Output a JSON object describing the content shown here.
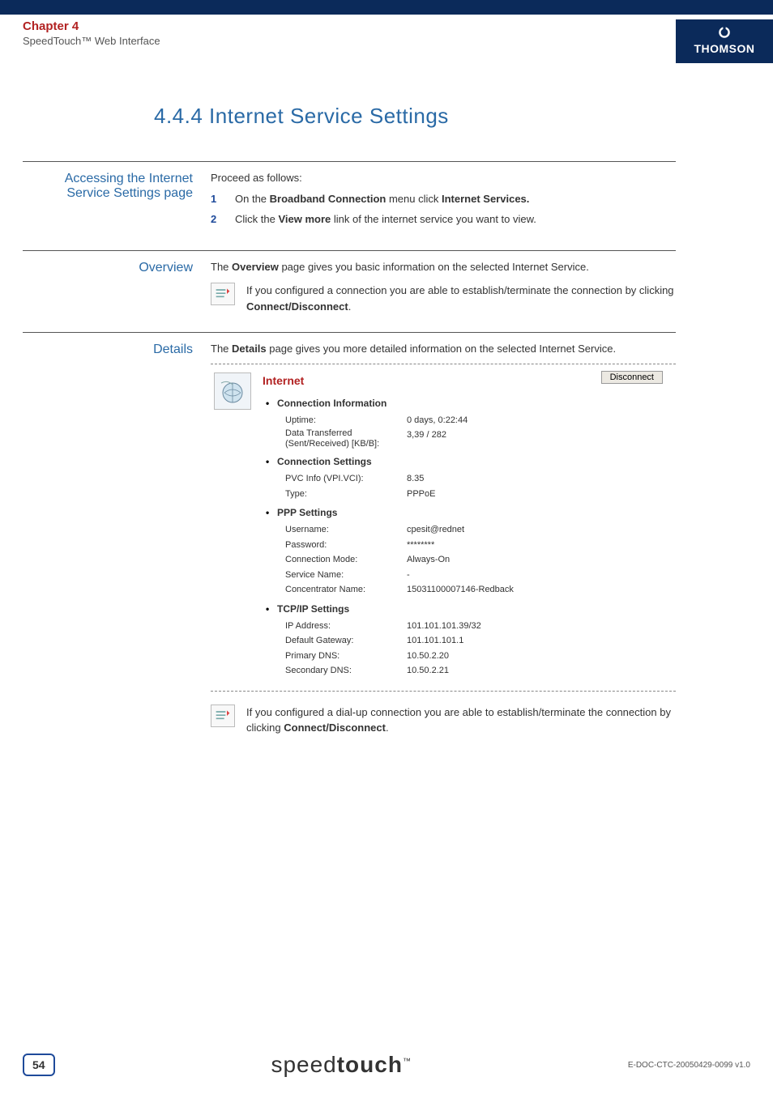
{
  "header": {
    "chapter": "Chapter 4",
    "subtitle": "SpeedTouch™ Web Interface",
    "brand": "THOMSON"
  },
  "page_title": "4.4.4  Internet Service Settings",
  "sections": {
    "accessing": {
      "label": "Accessing the Internet Service Settings page",
      "intro": "Proceed as follows:",
      "step1_num": "1",
      "step1_a": "On the ",
      "step1_b": "Broadband Connection",
      "step1_c": " menu click ",
      "step1_d": "Internet Services.",
      "step2_num": "2",
      "step2_a": "Click the ",
      "step2_b": "View more",
      "step2_c": " link of the internet service you want to view."
    },
    "overview": {
      "label": "Overview",
      "text_a": "The ",
      "text_b": "Overview",
      "text_c": " page gives you basic information on the selected Internet Service.",
      "note_a": "If you configured a connection you are able to establish/terminate the connection by clicking ",
      "note_b": "Connect/Disconnect",
      "note_c": "."
    },
    "details": {
      "label": "Details",
      "text_a": "The ",
      "text_b": "Details",
      "text_c": " page gives you more detailed information on the selected Internet Service.",
      "panel_title": "Internet",
      "disconnect": "Disconnect",
      "groups": {
        "conn_info": {
          "title": "Connection Information",
          "uptime_k": "Uptime:",
          "uptime_v": "0 days, 0:22:44",
          "data_k": "Data Transferred (Sent/Received) [KB/B]:",
          "data_v": "3,39 / 282"
        },
        "conn_settings": {
          "title": "Connection Settings",
          "pvc_k": "PVC Info (VPI.VCI):",
          "pvc_v": "8.35",
          "type_k": "Type:",
          "type_v": "PPPoE"
        },
        "ppp": {
          "title": "PPP Settings",
          "user_k": "Username:",
          "user_v": "cpesit@rednet",
          "pass_k": "Password:",
          "pass_v": "********",
          "mode_k": "Connection Mode:",
          "mode_v": "Always-On",
          "svc_k": "Service Name:",
          "svc_v": "-",
          "conc_k": "Concentrator Name:",
          "conc_v": "15031100007146-Redback"
        },
        "tcpip": {
          "title": "TCP/IP Settings",
          "ip_k": "IP Address:",
          "ip_v": "101.101.101.39/32",
          "gw_k": "Default Gateway:",
          "gw_v": "101.101.101.1",
          "dns1_k": "Primary DNS:",
          "dns1_v": "10.50.2.20",
          "dns2_k": "Secondary DNS:",
          "dns2_v": "10.50.2.21"
        }
      },
      "note2_a": "If you configured a dial-up connection you are able to establish/terminate the connection by clicking ",
      "note2_b": "Connect/Disconnect",
      "note2_c": "."
    }
  },
  "footer": {
    "page": "54",
    "logo_a": "speed",
    "logo_b": "touch",
    "docid": "E-DOC-CTC-20050429-0099 v1.0"
  }
}
